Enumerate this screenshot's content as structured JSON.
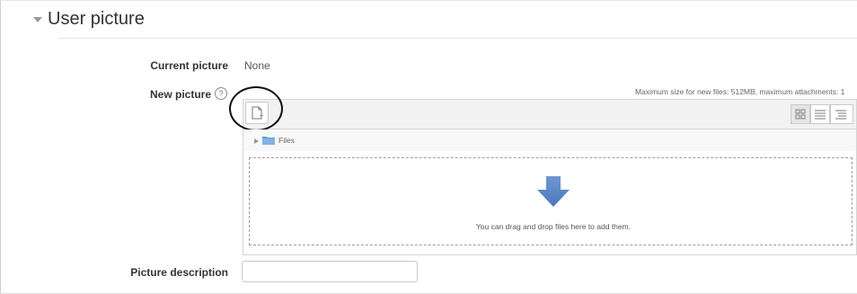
{
  "section": {
    "title": "User picture"
  },
  "current_picture": {
    "label": "Current picture",
    "value": "None"
  },
  "new_picture": {
    "label": "New picture",
    "help_icon": "question-circle-icon",
    "max_size_text": "Maximum size for new files: 512MB, maximum attachments: 1",
    "toolbar": {
      "add_file_icon": "add-file-icon",
      "view_icons": [
        "grid-view-icon",
        "list-view-icon",
        "tree-view-icon"
      ]
    },
    "path": {
      "label": "Files",
      "icon": "folder-icon"
    },
    "drop_zone": {
      "text": "You can drag and drop files here to add them.",
      "icon": "down-arrow-icon",
      "arrow_color": "#5b86c5"
    }
  },
  "picture_description": {
    "label": "Picture description",
    "value": ""
  },
  "annotation": {
    "color": "#111111"
  }
}
